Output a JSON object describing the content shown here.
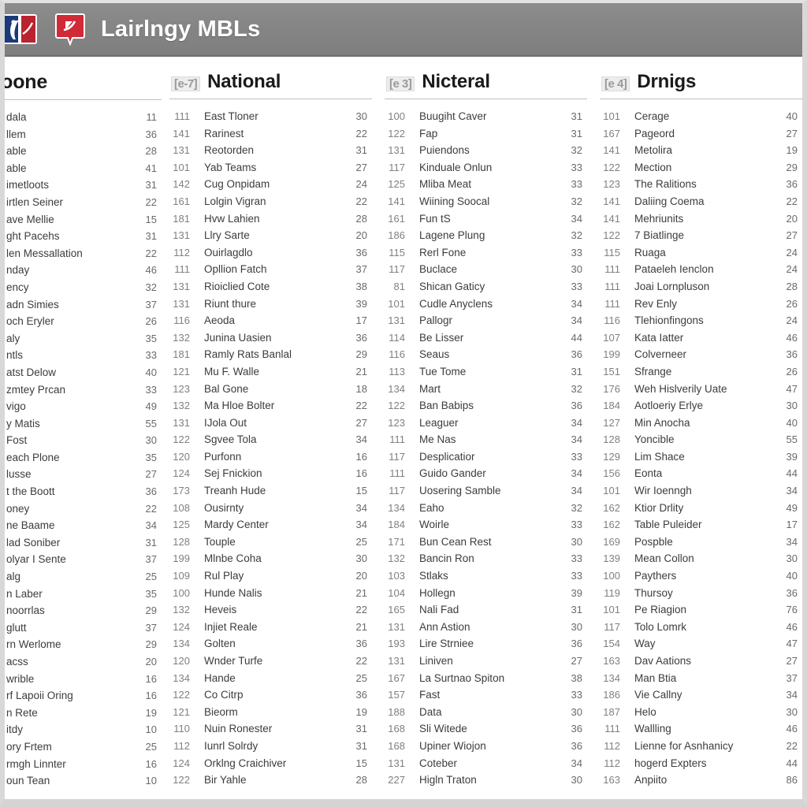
{
  "topbar": {
    "title": "Lairlngy MBLs",
    "mlb_logo_name": "mlb-logo-icon",
    "cap_logo_name": "team-cap-badge-icon"
  },
  "columns": [
    {
      "badge": "",
      "title": "esloone",
      "rows": [
        {
          "num": "",
          "label": "dala",
          "val": "11"
        },
        {
          "num": "",
          "label": "llem",
          "val": "36"
        },
        {
          "num": "",
          "label": "able",
          "val": "28"
        },
        {
          "num": "",
          "label": "able",
          "val": "41"
        },
        {
          "num": "",
          "label": "imetloots",
          "val": "31"
        },
        {
          "num": "",
          "label": "irtlen Seiner",
          "val": "22"
        },
        {
          "num": "",
          "label": "ave Mellie",
          "val": "15"
        },
        {
          "num": "",
          "label": "ght Pacehs",
          "val": "31"
        },
        {
          "num": "",
          "label": "len Messallation",
          "val": "22"
        },
        {
          "num": "",
          "label": "nday",
          "val": "46"
        },
        {
          "num": "",
          "label": "ency",
          "val": "32"
        },
        {
          "num": "",
          "label": "adn Simies",
          "val": "37"
        },
        {
          "num": "",
          "label": "och Eryler",
          "val": "26"
        },
        {
          "num": "",
          "label": "aly",
          "val": "35"
        },
        {
          "num": "",
          "label": "ntls",
          "val": "33"
        },
        {
          "num": "",
          "label": "atst Delow",
          "val": "40"
        },
        {
          "num": "",
          "label": "zmtey Prcan",
          "val": "33"
        },
        {
          "num": "",
          "label": "vigo",
          "val": "49"
        },
        {
          "num": "",
          "label": "y Matis",
          "val": "55"
        },
        {
          "num": "",
          "label": "Fost",
          "val": "30"
        },
        {
          "num": "",
          "label": "each Plone",
          "val": "35"
        },
        {
          "num": "",
          "label": "lusse",
          "val": "27"
        },
        {
          "num": "",
          "label": "t the Boott",
          "val": "36"
        },
        {
          "num": "",
          "label": "oney",
          "val": "22"
        },
        {
          "num": "",
          "label": "ne Baame",
          "val": "34"
        },
        {
          "num": "",
          "label": "lad Soniber",
          "val": "31"
        },
        {
          "num": "",
          "label": "olyar I Sente",
          "val": "37"
        },
        {
          "num": "",
          "label": "alg",
          "val": "25"
        },
        {
          "num": "",
          "label": "n Laber",
          "val": "35"
        },
        {
          "num": "",
          "label": "noorrlas",
          "val": "29"
        },
        {
          "num": "",
          "label": "glutt",
          "val": "37"
        },
        {
          "num": "",
          "label": "rn Werlome",
          "val": "29"
        },
        {
          "num": "",
          "label": "acss",
          "val": "20"
        },
        {
          "num": "",
          "label": "wrible",
          "val": "16"
        },
        {
          "num": "",
          "label": "rf Lapoii Oring",
          "val": "16"
        },
        {
          "num": "",
          "label": "n Rete",
          "val": "19"
        },
        {
          "num": "",
          "label": "itdy",
          "val": "10"
        },
        {
          "num": "",
          "label": "ory Frtem",
          "val": "25"
        },
        {
          "num": "",
          "label": "rmgh Linnter",
          "val": "16"
        },
        {
          "num": "",
          "label": "oun Tean",
          "val": "10"
        }
      ]
    },
    {
      "badge": "[e-7]",
      "title": "National",
      "rows": [
        {
          "num": "111",
          "label": "East Tloner",
          "val": "30"
        },
        {
          "num": "141",
          "label": "Rarinest",
          "val": "22"
        },
        {
          "num": "131",
          "label": "Reotorden",
          "val": "31"
        },
        {
          "num": "101",
          "label": "Yab Teams",
          "val": "27"
        },
        {
          "num": "142",
          "label": "Cug Onpidam",
          "val": "24"
        },
        {
          "num": "161",
          "label": "Lolgin Vigran",
          "val": "22"
        },
        {
          "num": "181",
          "label": "Hvw Lahien",
          "val": "28"
        },
        {
          "num": "131",
          "label": "Llry Sarte",
          "val": "20"
        },
        {
          "num": "112",
          "label": "Ouirlagdlo",
          "val": "36"
        },
        {
          "num": "111",
          "label": "Opllion Fatch",
          "val": "37"
        },
        {
          "num": "131",
          "label": "Rioiclied Cote",
          "val": "38"
        },
        {
          "num": "131",
          "label": "Riunt thure",
          "val": "39"
        },
        {
          "num": "116",
          "label": "Aeoda",
          "val": "17"
        },
        {
          "num": "132",
          "label": "Junina Uasien",
          "val": "36"
        },
        {
          "num": "181",
          "label": "Ramly Rats Banlal",
          "val": "29"
        },
        {
          "num": "121",
          "label": "Mu F. Walle",
          "val": "21"
        },
        {
          "num": "123",
          "label": "Bal Gone",
          "val": "18"
        },
        {
          "num": "132",
          "label": "Ma Hloe Bolter",
          "val": "22"
        },
        {
          "num": "131",
          "label": "IJola Out",
          "val": "27"
        },
        {
          "num": "122",
          "label": "Sgvee Tola",
          "val": "34"
        },
        {
          "num": "120",
          "label": "Purfonn",
          "val": "16"
        },
        {
          "num": "124",
          "label": "Sej Fnickion",
          "val": "16"
        },
        {
          "num": "173",
          "label": "Treanh Hude",
          "val": "15"
        },
        {
          "num": "108",
          "label": "Ousirnty",
          "val": "34"
        },
        {
          "num": "125",
          "label": "Mardy Center",
          "val": "34"
        },
        {
          "num": "128",
          "label": "Touple",
          "val": "25"
        },
        {
          "num": "199",
          "label": "Mlnbe Coha",
          "val": "30"
        },
        {
          "num": "109",
          "label": "Rul Play",
          "val": "20"
        },
        {
          "num": "100",
          "label": "Hunde Nalis",
          "val": "21"
        },
        {
          "num": "132",
          "label": "Heveis",
          "val": "22"
        },
        {
          "num": "124",
          "label": "Injiet Reale",
          "val": "21"
        },
        {
          "num": "134",
          "label": "Golten",
          "val": "36"
        },
        {
          "num": "120",
          "label": "Wnder Turfe",
          "val": "22"
        },
        {
          "num": "134",
          "label": "Hande",
          "val": "25"
        },
        {
          "num": "122",
          "label": "Co Citrp",
          "val": "36"
        },
        {
          "num": "121",
          "label": "Bieorm",
          "val": "19"
        },
        {
          "num": "110",
          "label": "Nuin Ronester",
          "val": "31"
        },
        {
          "num": "112",
          "label": "Iunrl Solrdy",
          "val": "31"
        },
        {
          "num": "124",
          "label": "Orklng Craichiver",
          "val": "15"
        },
        {
          "num": "122",
          "label": "Bir Yahle",
          "val": "28"
        }
      ]
    },
    {
      "badge": "[e 3]",
      "title": "Nicteral",
      "rows": [
        {
          "num": "100",
          "label": "Buugiht Caver",
          "val": "31"
        },
        {
          "num": "122",
          "label": "Fap",
          "val": "31"
        },
        {
          "num": "131",
          "label": "Puiendons",
          "val": "32"
        },
        {
          "num": "117",
          "label": "Kinduale Onlun",
          "val": "33"
        },
        {
          "num": "125",
          "label": "Mliba Meat",
          "val": "33"
        },
        {
          "num": "141",
          "label": "Wiining Soocal",
          "val": "32"
        },
        {
          "num": "161",
          "label": "Fun tS",
          "val": "34"
        },
        {
          "num": "186",
          "label": "Lagene Plung",
          "val": "32"
        },
        {
          "num": "115",
          "label": "Rerl Fone",
          "val": "33"
        },
        {
          "num": "117",
          "label": "Buclace",
          "val": "30"
        },
        {
          "num": "81",
          "label": "Shican Gaticy",
          "val": "33"
        },
        {
          "num": "101",
          "label": "Cudle Anyclens",
          "val": "34"
        },
        {
          "num": "131",
          "label": "Pallogr",
          "val": "34"
        },
        {
          "num": "114",
          "label": "Be Lisser",
          "val": "44"
        },
        {
          "num": "116",
          "label": "Seaus",
          "val": "36"
        },
        {
          "num": "113",
          "label": "Tue Tome",
          "val": "31"
        },
        {
          "num": "134",
          "label": "Mart",
          "val": "32"
        },
        {
          "num": "122",
          "label": "Ban Babips",
          "val": "36"
        },
        {
          "num": "123",
          "label": "Leaguer",
          "val": "34"
        },
        {
          "num": "111",
          "label": "Me Nas",
          "val": "34"
        },
        {
          "num": "117",
          "label": "Desplicatior",
          "val": "33"
        },
        {
          "num": "111",
          "label": "Guido Gander",
          "val": "34"
        },
        {
          "num": "117",
          "label": "Uosering Samble",
          "val": "34"
        },
        {
          "num": "134",
          "label": "Eaho",
          "val": "32"
        },
        {
          "num": "184",
          "label": "Woirle",
          "val": "33"
        },
        {
          "num": "171",
          "label": "Bun Cean Rest",
          "val": "30"
        },
        {
          "num": "132",
          "label": "Bancin Ron",
          "val": "33"
        },
        {
          "num": "103",
          "label": "Stlaks",
          "val": "33"
        },
        {
          "num": "104",
          "label": "Hollegn",
          "val": "39"
        },
        {
          "num": "165",
          "label": "Nali Fad",
          "val": "31"
        },
        {
          "num": "131",
          "label": "Ann Astion",
          "val": "30"
        },
        {
          "num": "193",
          "label": "Lire Strniee",
          "val": "36"
        },
        {
          "num": "131",
          "label": "Liniven",
          "val": "27"
        },
        {
          "num": "167",
          "label": "La Surtnao Spiton",
          "val": "38"
        },
        {
          "num": "157",
          "label": "Fast",
          "val": "33"
        },
        {
          "num": "188",
          "label": "Data",
          "val": "30"
        },
        {
          "num": "168",
          "label": "Sli Witede",
          "val": "36"
        },
        {
          "num": "168",
          "label": "Upiner Wiojon",
          "val": "36"
        },
        {
          "num": "131",
          "label": "Coteber",
          "val": "34"
        },
        {
          "num": "227",
          "label": "Higln Traton",
          "val": "30"
        }
      ]
    },
    {
      "badge": "[e 4]",
      "title": "Drnigs",
      "rows": [
        {
          "num": "101",
          "label": "Cerage",
          "val": "40"
        },
        {
          "num": "167",
          "label": "Pageord",
          "val": "27"
        },
        {
          "num": "141",
          "label": "Metolira",
          "val": "19"
        },
        {
          "num": "122",
          "label": "Mection",
          "val": "29"
        },
        {
          "num": "123",
          "label": "The Ralitions",
          "val": "36"
        },
        {
          "num": "141",
          "label": "Daliing Coema",
          "val": "22"
        },
        {
          "num": "141",
          "label": "Mehriunits",
          "val": "20"
        },
        {
          "num": "122",
          "label": "7 Biatlinge",
          "val": "27"
        },
        {
          "num": "115",
          "label": "Ruaga",
          "val": "24"
        },
        {
          "num": "111",
          "label": "Pataeleh Ienclon",
          "val": "24"
        },
        {
          "num": "111",
          "label": "Joai Lornpluson",
          "val": "28"
        },
        {
          "num": "111",
          "label": "Rev Enly",
          "val": "26"
        },
        {
          "num": "116",
          "label": "Tlehionfingons",
          "val": "24"
        },
        {
          "num": "107",
          "label": "Kata Iatter",
          "val": "46"
        },
        {
          "num": "199",
          "label": "Colverneer",
          "val": "36"
        },
        {
          "num": "151",
          "label": "Sfrange",
          "val": "26"
        },
        {
          "num": "176",
          "label": "Weh Hislverily Uate",
          "val": "47"
        },
        {
          "num": "184",
          "label": "Aotloeriy Erlye",
          "val": "30"
        },
        {
          "num": "127",
          "label": "Min Anocha",
          "val": "40"
        },
        {
          "num": "128",
          "label": "Yoncible",
          "val": "55"
        },
        {
          "num": "129",
          "label": "Lim Shace",
          "val": "39"
        },
        {
          "num": "156",
          "label": "Eonta",
          "val": "44"
        },
        {
          "num": "101",
          "label": "Wir Ioenngh",
          "val": "34"
        },
        {
          "num": "162",
          "label": "Ktior Drlity",
          "val": "49"
        },
        {
          "num": "162",
          "label": "Table Puleider",
          "val": "17"
        },
        {
          "num": "169",
          "label": "Pospble",
          "val": "34"
        },
        {
          "num": "139",
          "label": "Mean Collon",
          "val": "30"
        },
        {
          "num": "100",
          "label": "Paythers",
          "val": "40"
        },
        {
          "num": "119",
          "label": "Thursoy",
          "val": "36"
        },
        {
          "num": "101",
          "label": "Pe Riagion",
          "val": "76"
        },
        {
          "num": "117",
          "label": "Tolo Lomrk",
          "val": "46"
        },
        {
          "num": "154",
          "label": "Way",
          "val": "47"
        },
        {
          "num": "163",
          "label": "Dav Aations",
          "val": "27"
        },
        {
          "num": "134",
          "label": "Man Btia",
          "val": "37"
        },
        {
          "num": "186",
          "label": "Vie Callny",
          "val": "34"
        },
        {
          "num": "187",
          "label": "Helo",
          "val": "30"
        },
        {
          "num": "111",
          "label": "Wallling",
          "val": "46"
        },
        {
          "num": "112",
          "label": "Lienne for Asnhanicy",
          "val": "22"
        },
        {
          "num": "112",
          "label": "hogerd Expters",
          "val": "44"
        },
        {
          "num": "163",
          "label": "Anpiito",
          "val": "86"
        }
      ]
    }
  ]
}
